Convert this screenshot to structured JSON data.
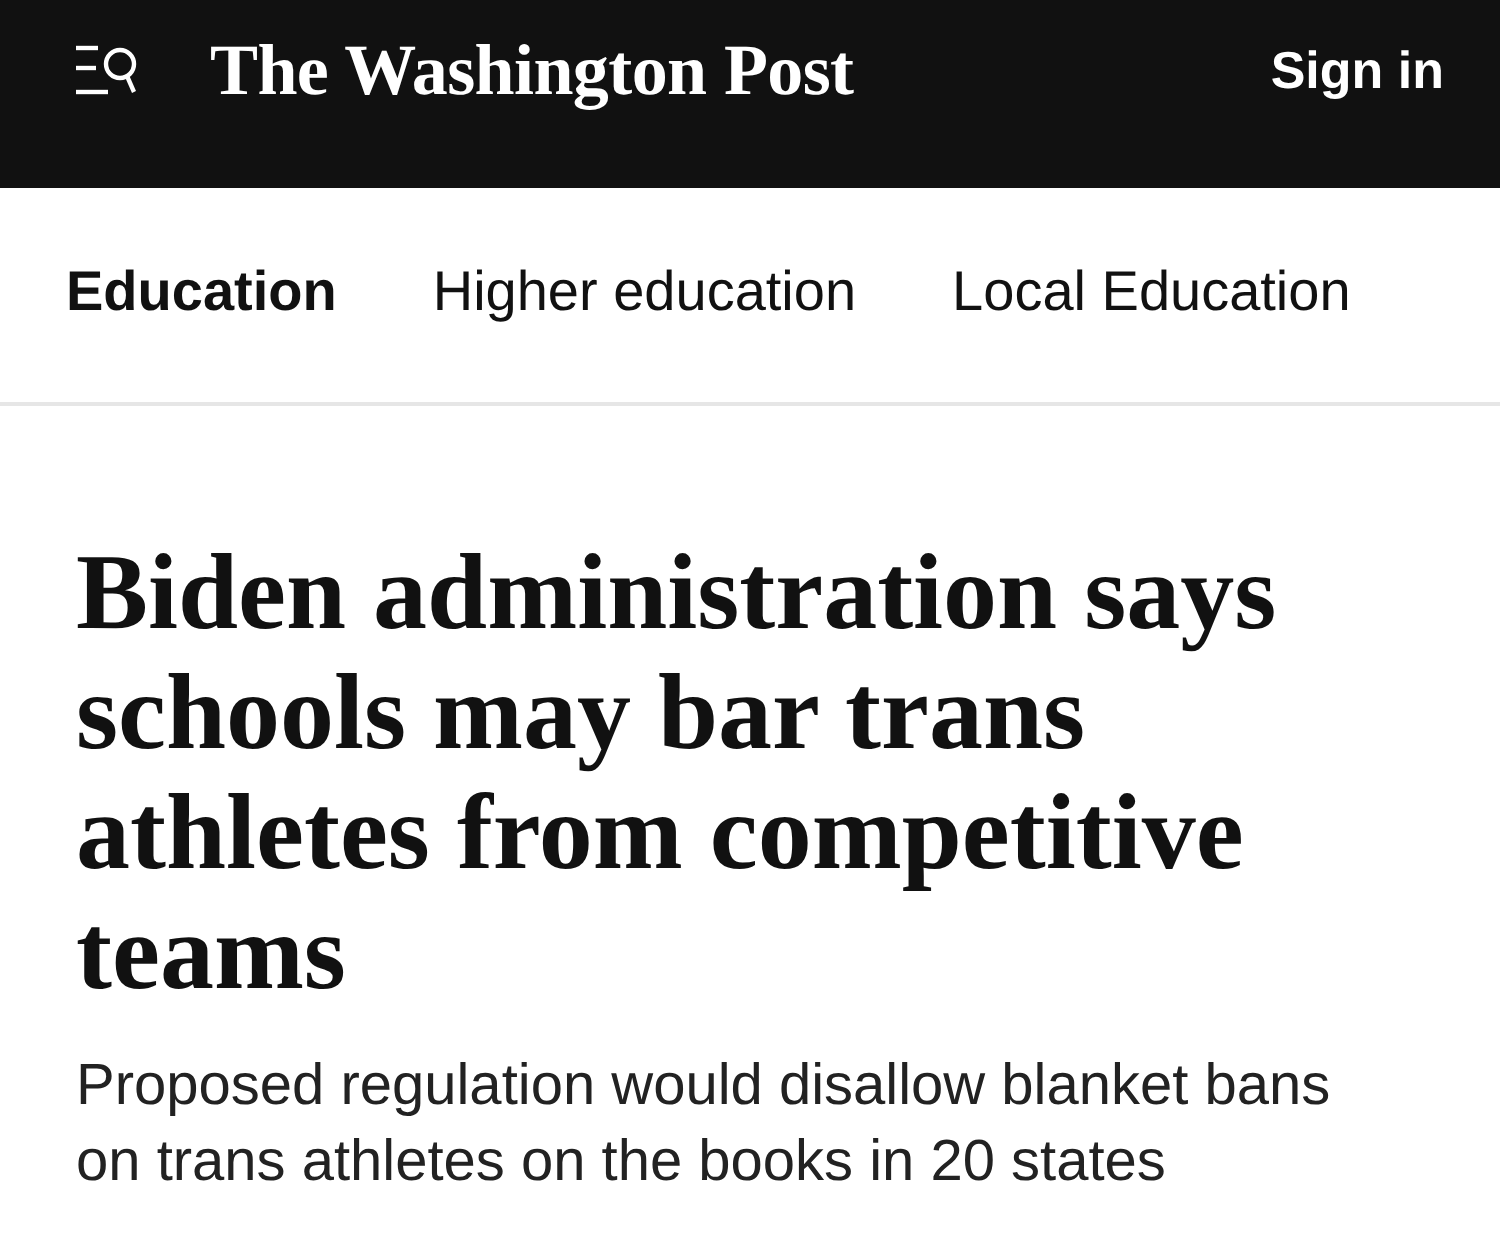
{
  "header": {
    "logo": "The Washington Post",
    "sign_in": "Sign in"
  },
  "section_nav": {
    "tabs": [
      {
        "label": "Education",
        "selected": true
      },
      {
        "label": "Higher education",
        "selected": false
      },
      {
        "label": "Local Education",
        "selected": false
      }
    ]
  },
  "article": {
    "headline": "Biden administration says schools may bar trans athletes from competitive teams",
    "subheadline": "Proposed regulation would disallow blanket bans on trans athletes on the books in 20 states"
  }
}
